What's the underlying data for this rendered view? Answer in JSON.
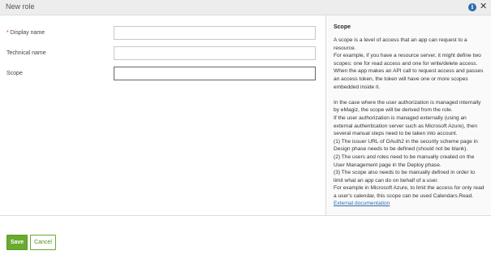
{
  "dialog": {
    "title": "New role",
    "info_icon": "info-icon",
    "close_glyph": "✕"
  },
  "form": {
    "fields": [
      {
        "label": "Display name",
        "required": true,
        "value": ""
      },
      {
        "label": "Technical name",
        "required": false,
        "value": ""
      },
      {
        "label": "Scope",
        "required": false,
        "value": ""
      }
    ],
    "required_marker": "*"
  },
  "help": {
    "title": "Scope",
    "paragraphs": [
      "A scope is a level of access that an app can request to a resource.",
      "For example, if you have a resource server, it might define two scopes: one for read access and one for write/delete access. When the app makes an API call to request access and passes an access token, the token will have one or more scopes embedded inside it.",
      "",
      "In the case where the user authorization is managed internally by eMagiz, the scope will be derived from the role.",
      "If the user authorization is managed externally (using an external authentication server such as Microsoft Azure), then several manual steps need to be taken into account.",
      "(1) The issuer URL of OAuth2 in the security scheme page in Design phase needs to be defined (should not be blank).",
      "(2) The users and roles need to be manually created on the User Management page in the Deploy phase.",
      "(3) The scope also needs to be manually defined in order to limit what an app can do on behalf of a user.",
      "For example in Microsoft Azure, to limit the access for only read a user's calendar, this scope can be used Calendars.Read."
    ],
    "link_text": "External documentation"
  },
  "footer": {
    "save_label": "Save",
    "cancel_label": "Cancel"
  },
  "colors": {
    "accent_green": "#6aaa2e",
    "link_blue": "#2b6cb0",
    "required_red": "#c0392b"
  }
}
